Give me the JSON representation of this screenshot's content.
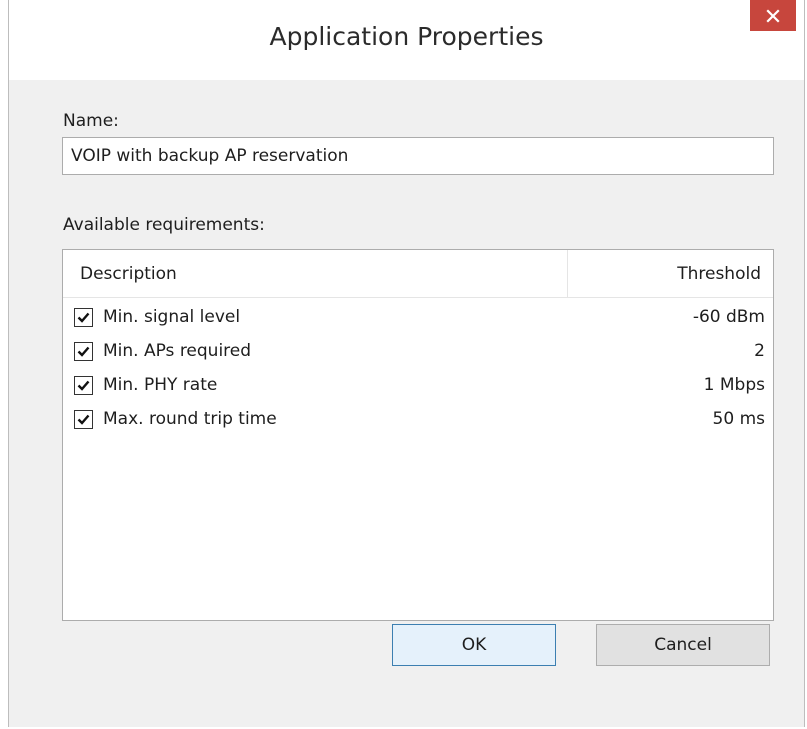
{
  "window": {
    "title": "Application Properties"
  },
  "form": {
    "name_label": "Name:",
    "name_value": "VOIP with backup AP reservation",
    "available_label": "Available requirements:"
  },
  "table": {
    "columns": [
      "Description",
      "Threshold"
    ],
    "rows": [
      {
        "checked": true,
        "description": "Min. signal level",
        "threshold": "-60 dBm"
      },
      {
        "checked": true,
        "description": "Min. APs required",
        "threshold": "2"
      },
      {
        "checked": true,
        "description": "Min. PHY rate",
        "threshold": "1 Mbps"
      },
      {
        "checked": true,
        "description": "Max. round trip time",
        "threshold": "50 ms"
      }
    ]
  },
  "buttons": {
    "ok": "OK",
    "cancel": "Cancel"
  },
  "icons": {
    "close": "close-icon",
    "check": "checkmark-icon"
  },
  "colors": {
    "close_button": "#c7463d",
    "ok_border": "#3c7fb1",
    "dialog_bg": "#f0f0f0"
  }
}
